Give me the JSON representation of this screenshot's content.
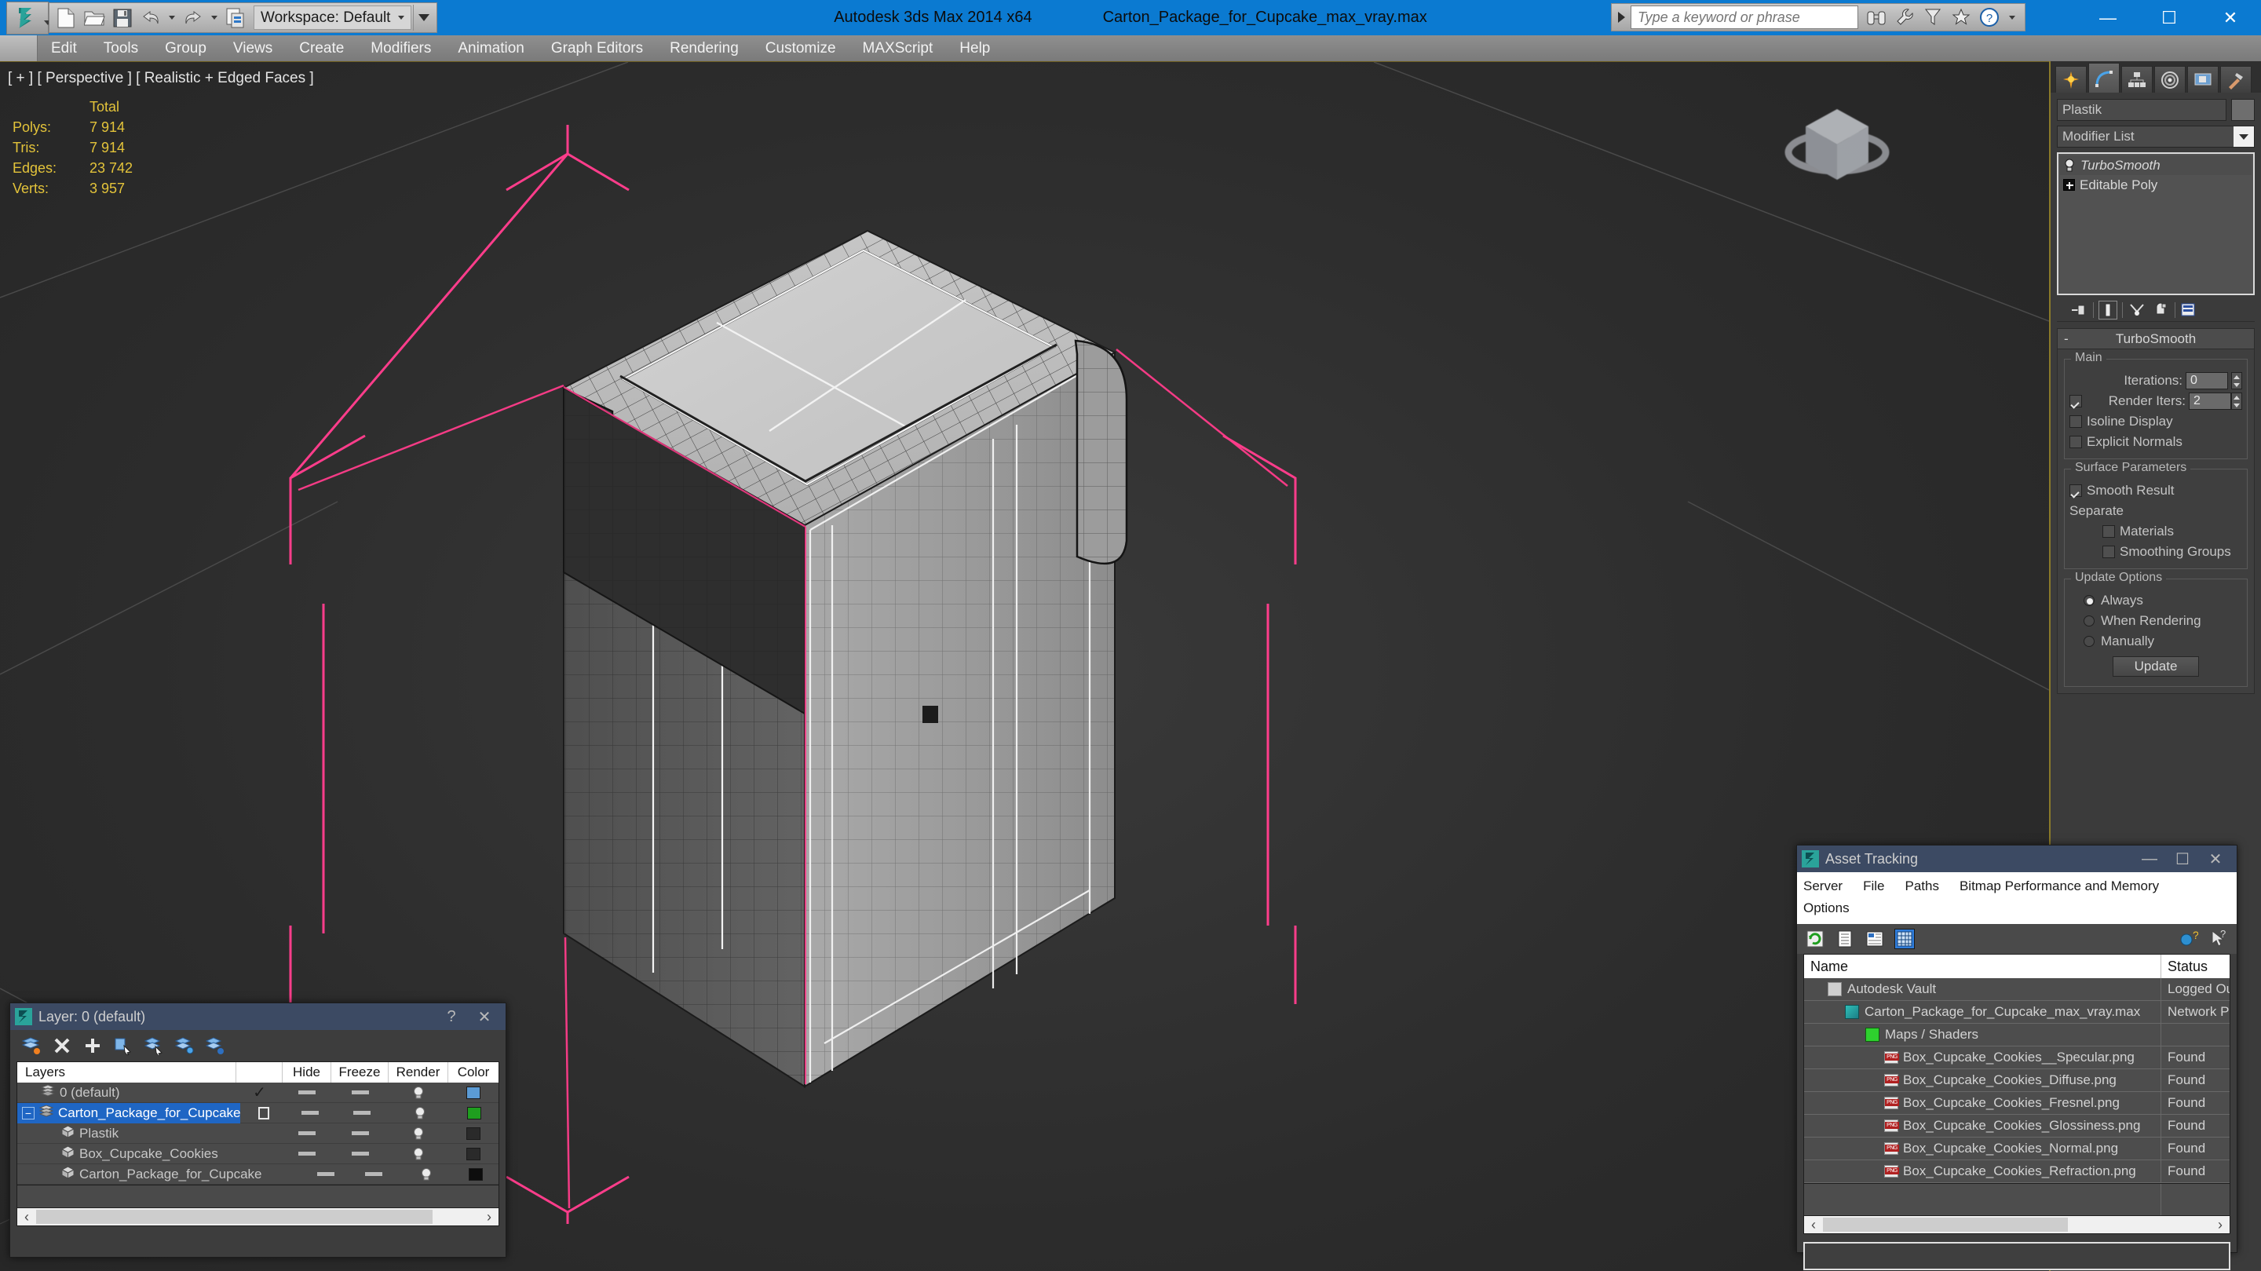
{
  "titlebar": {
    "app_title": "Autodesk 3ds Max  2014 x64",
    "file_title": "Carton_Package_for_Cupcake_max_vray.max",
    "workspace_label": "Workspace: Default",
    "search_placeholder": "Type a keyword or phrase",
    "quick_access": [
      {
        "name": "new-file-icon",
        "label": "New"
      },
      {
        "name": "open-file-icon",
        "label": "Open"
      },
      {
        "name": "save-file-icon",
        "label": "Save"
      },
      {
        "name": "undo-icon",
        "label": "Undo"
      },
      {
        "name": "redo-icon",
        "label": "Redo"
      },
      {
        "name": "project-folder-icon",
        "label": "Set Project Folder"
      }
    ],
    "help_icons": [
      "binoculars-icon",
      "wrench-icon",
      "funnel-icon",
      "star-icon",
      "help-icon"
    ],
    "window_buttons": {
      "minimize": "—",
      "maximize": "☐",
      "close": "✕"
    }
  },
  "menubar": {
    "items": [
      "Edit",
      "Tools",
      "Group",
      "Views",
      "Create",
      "Modifiers",
      "Animation",
      "Graph Editors",
      "Rendering",
      "Customize",
      "MAXScript",
      "Help"
    ]
  },
  "viewport": {
    "label": "[ + ] [ Perspective ] [ Realistic + Edged Faces ]",
    "stats_header": "Total",
    "stats": [
      {
        "label": "Polys:",
        "value": "7 914"
      },
      {
        "label": "Tris:",
        "value": "7 914"
      },
      {
        "label": "Edges:",
        "value": "23 742"
      },
      {
        "label": "Verts:",
        "value": "3 957"
      }
    ],
    "selection_color": "#ff3d8b",
    "background_color": "#2f2f2f"
  },
  "command_panel": {
    "tabs": [
      {
        "name": "create-tab",
        "label": "Create"
      },
      {
        "name": "modify-tab",
        "label": "Modify",
        "active": true
      },
      {
        "name": "hierarchy-tab",
        "label": "Hierarchy"
      },
      {
        "name": "motion-tab",
        "label": "Motion"
      },
      {
        "name": "display-tab",
        "label": "Display"
      },
      {
        "name": "utilities-tab",
        "label": "Utilities"
      }
    ],
    "object_name": "Plastik",
    "modifier_list_label": "Modifier List",
    "stack": [
      {
        "label": "TurboSmooth",
        "selected": true,
        "italic": true
      },
      {
        "label": "Editable Poly",
        "selected": false,
        "italic": false
      }
    ],
    "rollout": {
      "title": "TurboSmooth",
      "collapse_glyph": "-",
      "main_group": "Main",
      "iterations_label": "Iterations:",
      "iterations_value": "0",
      "render_iters_label": "Render Iters:",
      "render_iters_value": "2",
      "render_iters_checked": true,
      "isoline_label": "Isoline Display",
      "isoline_checked": false,
      "explicit_normals_label": "Explicit Normals",
      "explicit_normals_checked": false,
      "surface_group": "Surface Parameters",
      "smooth_result_label": "Smooth Result",
      "smooth_result_checked": true,
      "separate_label": "Separate",
      "materials_label": "Materials",
      "materials_checked": false,
      "smoothing_groups_label": "Smoothing Groups",
      "smoothing_groups_checked": false,
      "update_group": "Update Options",
      "update_options": [
        {
          "label": "Always",
          "selected": true
        },
        {
          "label": "When Rendering",
          "selected": false
        },
        {
          "label": "Manually",
          "selected": false
        }
      ],
      "update_button": "Update"
    }
  },
  "layer_dialog": {
    "title": "Layer: 0 (default)",
    "help_glyph": "?",
    "close_glyph": "✕",
    "toolbar_icons": [
      "create-new-layer-icon",
      "delete-layer-icon",
      "add-layer-icon",
      "select-objects-in-layer-icon",
      "highlight-selected-objects-icon",
      "add-selection-to-layer-icon",
      "set-layer-to-selection-icon"
    ],
    "columns": [
      "Layers",
      "",
      "Hide",
      "Freeze",
      "Render",
      "Color"
    ],
    "rows": [
      {
        "name": "0 (default)",
        "indent": 1,
        "icon": "layer-icon",
        "expander": "",
        "active": "✓",
        "hide": "dash",
        "freeze": "dash",
        "render": "bulb",
        "color": "#5b9bd5",
        "selected": false
      },
      {
        "name": "Carton_Package_for_Cupcake",
        "indent": 0,
        "icon": "layer-icon",
        "expander": "minus",
        "active": "box",
        "hide": "dash",
        "freeze": "dash",
        "render": "bulb",
        "color": "#1f9e1f",
        "selected": true
      },
      {
        "name": "Plastik",
        "indent": 2,
        "icon": "object-icon",
        "expander": "",
        "active": "",
        "hide": "dash",
        "freeze": "dash",
        "render": "bulb",
        "color": "#2a2a2a",
        "selected": false
      },
      {
        "name": "Box_Cupcake_Cookies",
        "indent": 2,
        "icon": "object-icon",
        "expander": "",
        "active": "",
        "hide": "dash",
        "freeze": "dash",
        "render": "bulb",
        "color": "#2a2a2a",
        "selected": false
      },
      {
        "name": "Carton_Package_for_Cupcake",
        "indent": 2,
        "icon": "object-icon",
        "expander": "",
        "active": "",
        "hide": "dash",
        "freeze": "dash",
        "render": "bulb",
        "color": "#0d0d0d",
        "selected": false
      }
    ]
  },
  "asset_tracking": {
    "title": "Asset Tracking",
    "window_buttons": {
      "minimize": "—",
      "maximize": "☐",
      "close": "✕"
    },
    "menu_row1": [
      "Server",
      "File",
      "Paths",
      "Bitmap Performance and Memory"
    ],
    "menu_row2": [
      "Options"
    ],
    "toolbar_icons": [
      "refresh-icon",
      "list-view-icon",
      "details-view-icon",
      "grid-view-icon"
    ],
    "toolbar_right_icons": [
      "help-globe-icon",
      "context-help-icon"
    ],
    "columns": [
      "Name",
      "Status"
    ],
    "rows": [
      {
        "name": "Autodesk Vault",
        "status": "Logged Ou",
        "indent": 1,
        "icon": "vault-icon"
      },
      {
        "name": "Carton_Package_for_Cupcake_max_vray.max",
        "status": "Network P",
        "indent": 2,
        "icon": "max-file-icon"
      },
      {
        "name": "Maps / Shaders",
        "status": "",
        "indent": 3,
        "icon": "maps-shaders-icon"
      },
      {
        "name": "Box_Cupcake_Cookies__Specular.png",
        "status": "Found",
        "indent": 4,
        "icon": "png-icon"
      },
      {
        "name": "Box_Cupcake_Cookies_Diffuse.png",
        "status": "Found",
        "indent": 4,
        "icon": "png-icon"
      },
      {
        "name": "Box_Cupcake_Cookies_Fresnel.png",
        "status": "Found",
        "indent": 4,
        "icon": "png-icon"
      },
      {
        "name": "Box_Cupcake_Cookies_Glossiness.png",
        "status": "Found",
        "indent": 4,
        "icon": "png-icon"
      },
      {
        "name": "Box_Cupcake_Cookies_Normal.png",
        "status": "Found",
        "indent": 4,
        "icon": "png-icon"
      },
      {
        "name": "Box_Cupcake_Cookies_Refraction.png",
        "status": "Found",
        "indent": 4,
        "icon": "png-icon"
      }
    ]
  }
}
